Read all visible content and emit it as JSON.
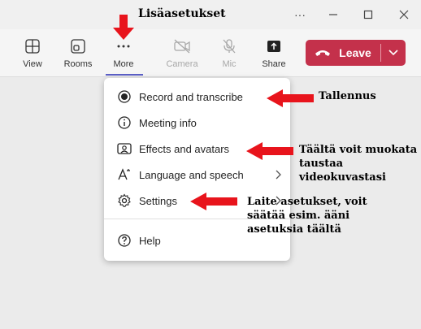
{
  "window": {
    "title": "Lisäasetukset"
  },
  "toolbar": {
    "view": "View",
    "rooms": "Rooms",
    "more": "More",
    "camera": "Camera",
    "mic": "Mic",
    "share": "Share",
    "leave": "Leave"
  },
  "menu": {
    "items": [
      {
        "label": "Record and transcribe",
        "icon": "record-icon"
      },
      {
        "label": "Meeting info",
        "icon": "info-icon"
      },
      {
        "label": "Effects and avatars",
        "icon": "effects-icon"
      },
      {
        "label": "Language and speech",
        "icon": "language-icon"
      },
      {
        "label": "Settings",
        "icon": "gear-icon"
      },
      {
        "label": "Help",
        "icon": "help-icon"
      }
    ]
  },
  "annotations": {
    "record": "Tallennus",
    "effects_line1": "Täältä voit muokata",
    "effects_line2": "taustaa videokuvastasi",
    "settings_line1": "Laite asetukset, voit",
    "settings_line2": "säätää esim. ääni",
    "settings_line3": "asetuksia täältä"
  },
  "colors": {
    "leave": "#c4314b",
    "accent": "#5b5fc7",
    "arrow": "#e8141c"
  }
}
